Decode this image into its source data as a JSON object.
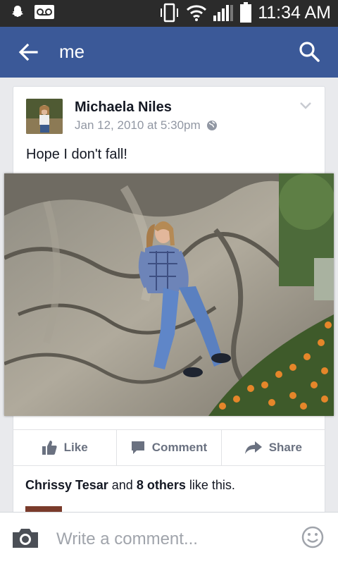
{
  "statusbar": {
    "time": "11:34 AM",
    "signal_bars": 4,
    "battery_level": 0.9
  },
  "appbar": {
    "title": "me",
    "back_icon": "arrow-left-icon",
    "search_icon": "search-icon",
    "color": "#3b5998"
  },
  "post": {
    "author": "Michaela Niles",
    "timestamp": "Jan 12, 2010 at 5:30pm",
    "privacy_icon": "globe-icon",
    "text": "Hope I don't fall!"
  },
  "actions": {
    "like": "Like",
    "comment": "Comment",
    "share": "Share"
  },
  "likes": {
    "first_name": "Chrissy Tesar",
    "connector": "and",
    "others": "8 others",
    "suffix": "like this."
  },
  "comment": {
    "placeholder": "Write a comment..."
  }
}
